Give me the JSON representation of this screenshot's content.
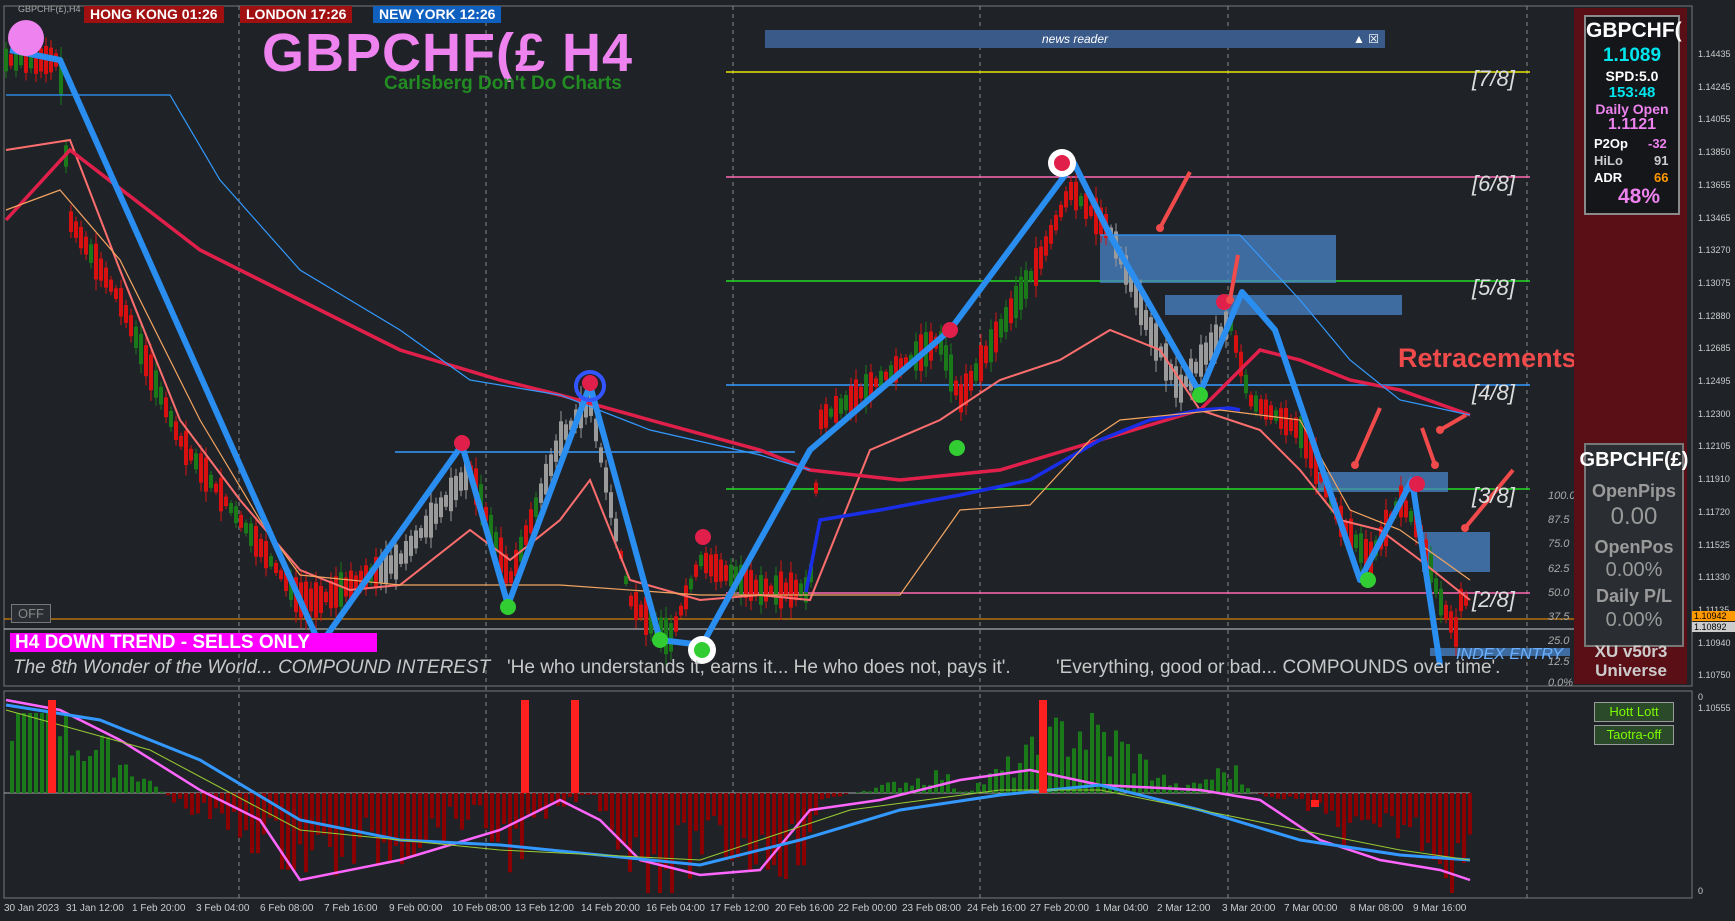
{
  "window": {
    "symbol_tab": "GBPCHF(£),H4"
  },
  "clocks": [
    {
      "label": "HONG KONG 01:26",
      "color": "#a01010"
    },
    {
      "label": "LONDON   17:26",
      "color": "#a01010"
    },
    {
      "label": "NEW YORK  12:26",
      "color": "#1060c0"
    }
  ],
  "header": {
    "title": "GBPCHF(£ H4",
    "subtitle": "Carlsberg Don't Do Charts"
  },
  "news": {
    "label": "news reader",
    "controls": "▲ ☒"
  },
  "levels": [
    {
      "label": "[7/8]",
      "color": "#e8e800"
    },
    {
      "label": "[6/8]",
      "color": "#ff69b4"
    },
    {
      "label": "[5/8]",
      "color": "#22dd22"
    },
    {
      "label": "[4/8]",
      "color": "#3399ff"
    },
    {
      "label": "[3/8]",
      "color": "#22dd22"
    },
    {
      "label": "[2/8]",
      "color": "#ff69b4"
    }
  ],
  "annotations": {
    "retracements": "Retracements",
    "index_entry": "INDEX ENTRY"
  },
  "status": {
    "trend": "H4  DOWN TREND - SELLS ONLY",
    "off_button": "OFF",
    "quote1": "The 8th Wonder of the World... COMPOUND INTEREST",
    "quote2": "'He who understands it, earns it... He who does not, pays it'.",
    "quote3": "'Everything, good or bad... COMPOUNDS over time'."
  },
  "percent_scale": [
    "100.0",
    "87.5",
    "75.0",
    "62.5",
    "50.0",
    "37.5",
    "25.0",
    "12.5",
    "0.0%"
  ],
  "info_panel": {
    "symbol": "GBPCHF(",
    "price": "1.1089",
    "spread": "SPD:5.0",
    "timer": "153:48",
    "daily_open_label": "Daily Open",
    "daily_open": "1.1121",
    "p2op_label": "P2Op",
    "p2op": "-32",
    "hilo_label": "HiLo",
    "hilo": "91",
    "adr_label": "ADR",
    "adr": "66",
    "pct": "48%"
  },
  "pl_panel": {
    "symbol": "GBPCHF(£)",
    "open_pips_label": "OpenPips",
    "open_pips": "0.00",
    "open_pos_label": "OpenPos",
    "open_pos": "0.00%",
    "daily_pl_label": "Daily P/L",
    "daily_pl": "0.00%"
  },
  "branding": {
    "line1": "XU v50r3",
    "line2": "Universe"
  },
  "indicator_buttons": {
    "hott": "Hott Lott",
    "taotra": "Taotra-off"
  },
  "price_axis": [
    "1.14435",
    "1.14245",
    "1.14055",
    "1.13850",
    "1.13655",
    "1.13465",
    "1.13270",
    "1.13075",
    "1.12880",
    "1.12685",
    "1.12495",
    "1.12300",
    "1.12105",
    "1.11910",
    "1.11720",
    "1.11525",
    "1.11330",
    "1.11135",
    "1.10940",
    "1.10750",
    "1.10555"
  ],
  "current_prices": {
    "ask": "1.10942",
    "bid": "1.10892"
  },
  "sub_axis": {
    "top": "0",
    "bottom": "0"
  },
  "time_axis": [
    "30 Jan 2023",
    "31 Jan 12:00",
    "1 Feb 20:00",
    "3 Feb 04:00",
    "6 Feb 08:00",
    "7 Feb 16:00",
    "9 Feb 00:00",
    "10 Feb 08:00",
    "13 Feb 12:00",
    "14 Feb 20:00",
    "16 Feb 04:00",
    "17 Feb 12:00",
    "20 Feb 16:00",
    "22 Feb 00:00",
    "23 Feb 08:00",
    "24 Feb 16:00",
    "27 Feb 20:00",
    "1 Mar 04:00",
    "2 Mar 12:00",
    "3 Mar 20:00",
    "7 Mar 00:00",
    "8 Mar 08:00",
    "9 Mar 16:00"
  ],
  "colors": {
    "background": "#1f2328",
    "bull": "#1a7a1a",
    "bear": "#d81010",
    "neutral": "#9a9a9a",
    "zigzag": "#2a8df0",
    "ema_slow": "#e0204a",
    "ema_fast": "#1a2ee8",
    "panel": "#5a0e16"
  }
}
